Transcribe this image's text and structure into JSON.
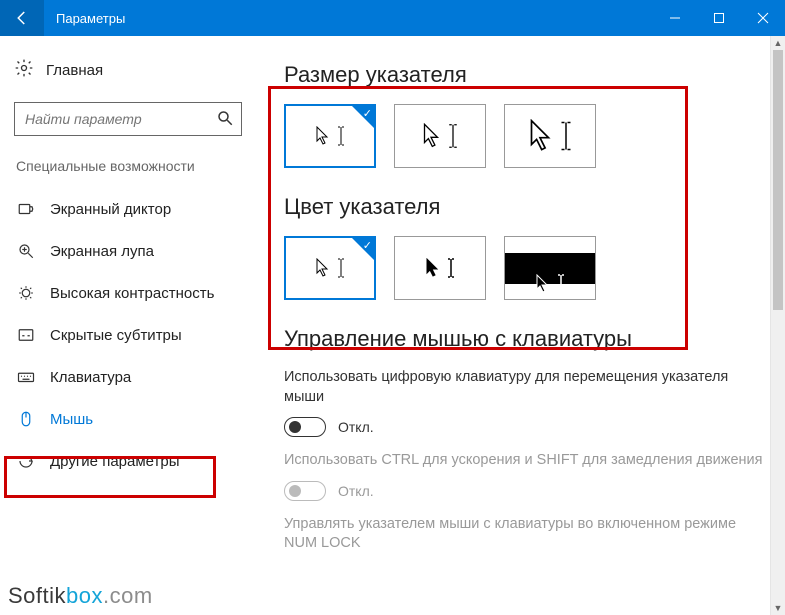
{
  "colors": {
    "accent": "#0078d7",
    "highlight": "#c00"
  },
  "titlebar": {
    "title": "Параметры"
  },
  "sidebar": {
    "home": "Главная",
    "search_placeholder": "Найти параметр",
    "section": "Специальные возможности",
    "items": [
      {
        "icon": "narrator-icon",
        "label": "Экранный диктор"
      },
      {
        "icon": "magnifier-icon",
        "label": "Экранная лупа"
      },
      {
        "icon": "contrast-icon",
        "label": "Высокая контрастность"
      },
      {
        "icon": "captions-icon",
        "label": "Скрытые субтитры"
      },
      {
        "icon": "keyboard-icon",
        "label": "Клавиатура"
      },
      {
        "icon": "mouse-icon",
        "label": "Мышь"
      },
      {
        "icon": "other-icon",
        "label": "Другие параметры"
      }
    ],
    "active_index": 5
  },
  "main": {
    "pointer_size": {
      "heading": "Размер указателя",
      "options": [
        "small",
        "medium",
        "large"
      ],
      "selected": 0
    },
    "pointer_color": {
      "heading": "Цвет указателя",
      "options": [
        "white",
        "black",
        "invert"
      ],
      "selected": 0
    },
    "mouse_keys": {
      "heading": "Управление мышью с клавиатуры",
      "desc1": "Использовать цифровую клавиатуру для перемещения указателя мыши",
      "toggle1": {
        "on": false,
        "label": "Откл."
      },
      "desc2": "Использовать CTRL для ускорения и SHIFT для замедления движения",
      "toggle2": {
        "on": false,
        "label": "Откл.",
        "disabled": true
      },
      "desc3": "Управлять указателем мыши с клавиатуры во включенном режиме NUM LOCK"
    }
  },
  "watermark": {
    "a": "Softik",
    "b": "box",
    "c": ".com"
  }
}
